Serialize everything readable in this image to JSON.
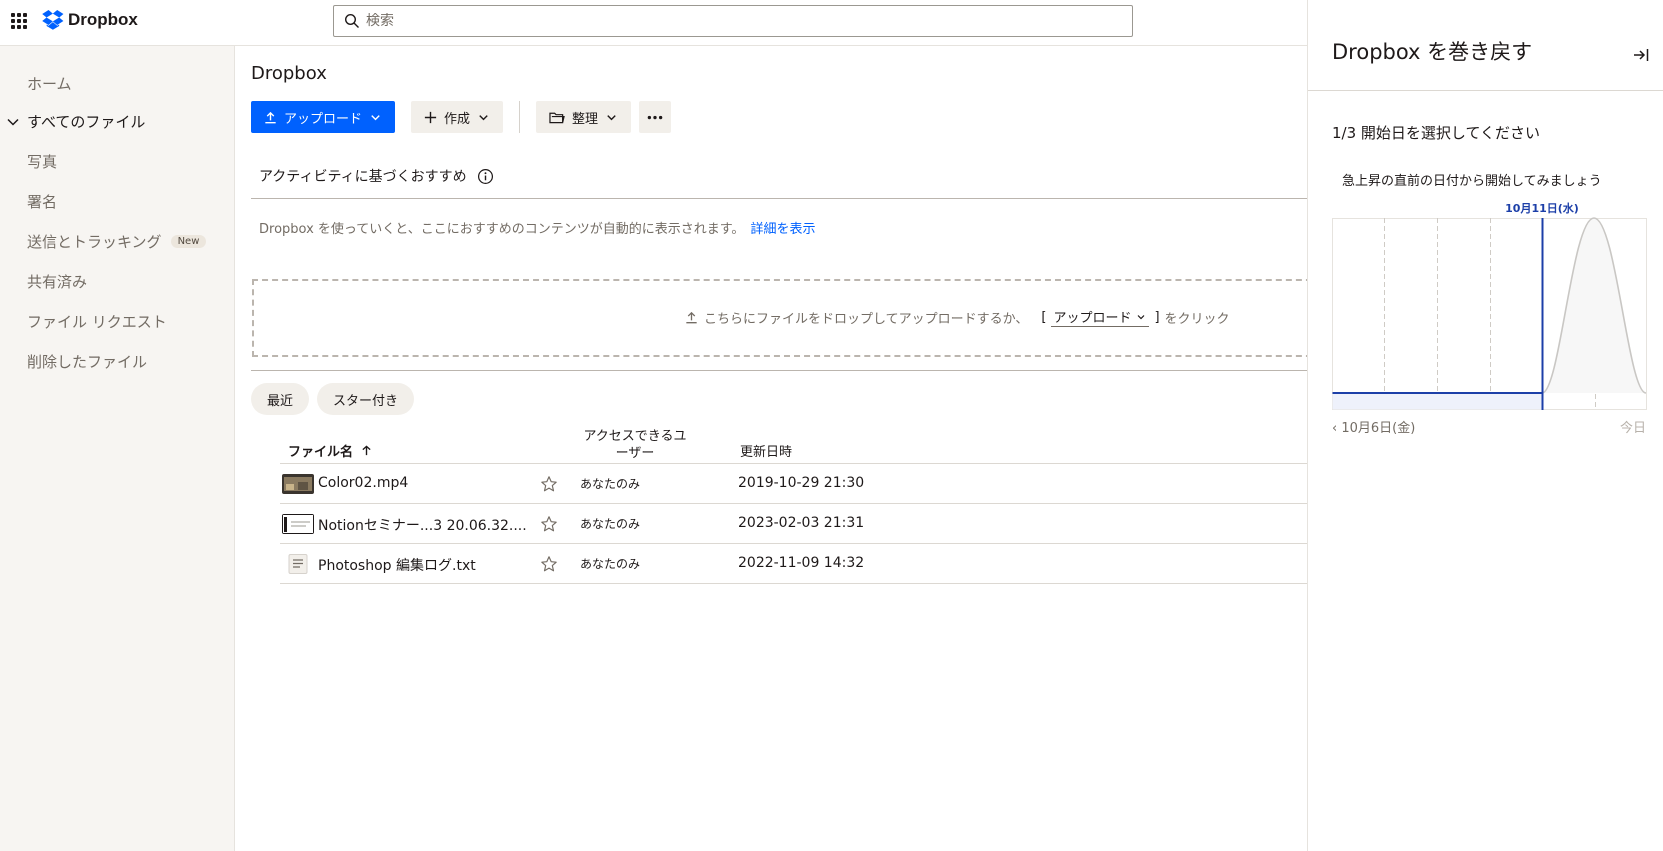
{
  "header": {
    "app_name": "Dropbox",
    "search_placeholder": "検索"
  },
  "sidebar": {
    "items": [
      {
        "label": "ホーム"
      },
      {
        "label": "すべてのファイル",
        "active": true
      },
      {
        "label": "写真"
      },
      {
        "label": "署名"
      },
      {
        "label": "送信とトラッキング",
        "badge": "New"
      },
      {
        "label": "共有済み"
      },
      {
        "label": "ファイル リクエスト"
      },
      {
        "label": "削除したファイル"
      }
    ]
  },
  "main": {
    "title": "Dropbox",
    "toolbar": {
      "upload": "アップロード",
      "create": "作成",
      "organize": "整理"
    },
    "recommendations": {
      "title": "アクティビティに基づくおすすめ",
      "desc": "Dropbox を使っていくと、ここにおすすめのコンテンツが自動的に表示されます。",
      "link": "詳細を表示"
    },
    "dropzone": {
      "text_before": "こちらにファイルをドロップしてアップロードするか、",
      "bracket_open": "[",
      "upload_label": "アップロード",
      "bracket_close": "]",
      "text_after": "をクリック"
    },
    "chips": [
      "最近",
      "スター付き"
    ],
    "table": {
      "col_name": "ファイル名",
      "col_access": "アクセスできるユーザー",
      "col_date": "更新日時",
      "rows": [
        {
          "name": "Color02.mp4",
          "access": "あなたのみ",
          "date": "2019-10-29 21:30",
          "thumb": "video"
        },
        {
          "name": "Notionセミナー...3 20.06.32....",
          "access": "あなたのみ",
          "date": "2023-02-03 21:31",
          "thumb": "screenshot"
        },
        {
          "name": "Photoshop 編集ログ.txt",
          "access": "あなたのみ",
          "date": "2022-11-09 14:32",
          "thumb": "text"
        }
      ]
    }
  },
  "panel": {
    "title": "Dropbox を巻き戻す",
    "step": "1/3 開始日を選択してください",
    "hint": "急上昇の直前の日付から開始してみましょう",
    "selected_label": "10月11日(水)",
    "x_left": "‹ 10月6日(金)",
    "x_right": "今日"
  },
  "colors": {
    "accent": "#0061fe",
    "selection": "#1c3fa8",
    "sidebar_bg": "#f7f5f2",
    "chip_bg": "#f2efea"
  }
}
